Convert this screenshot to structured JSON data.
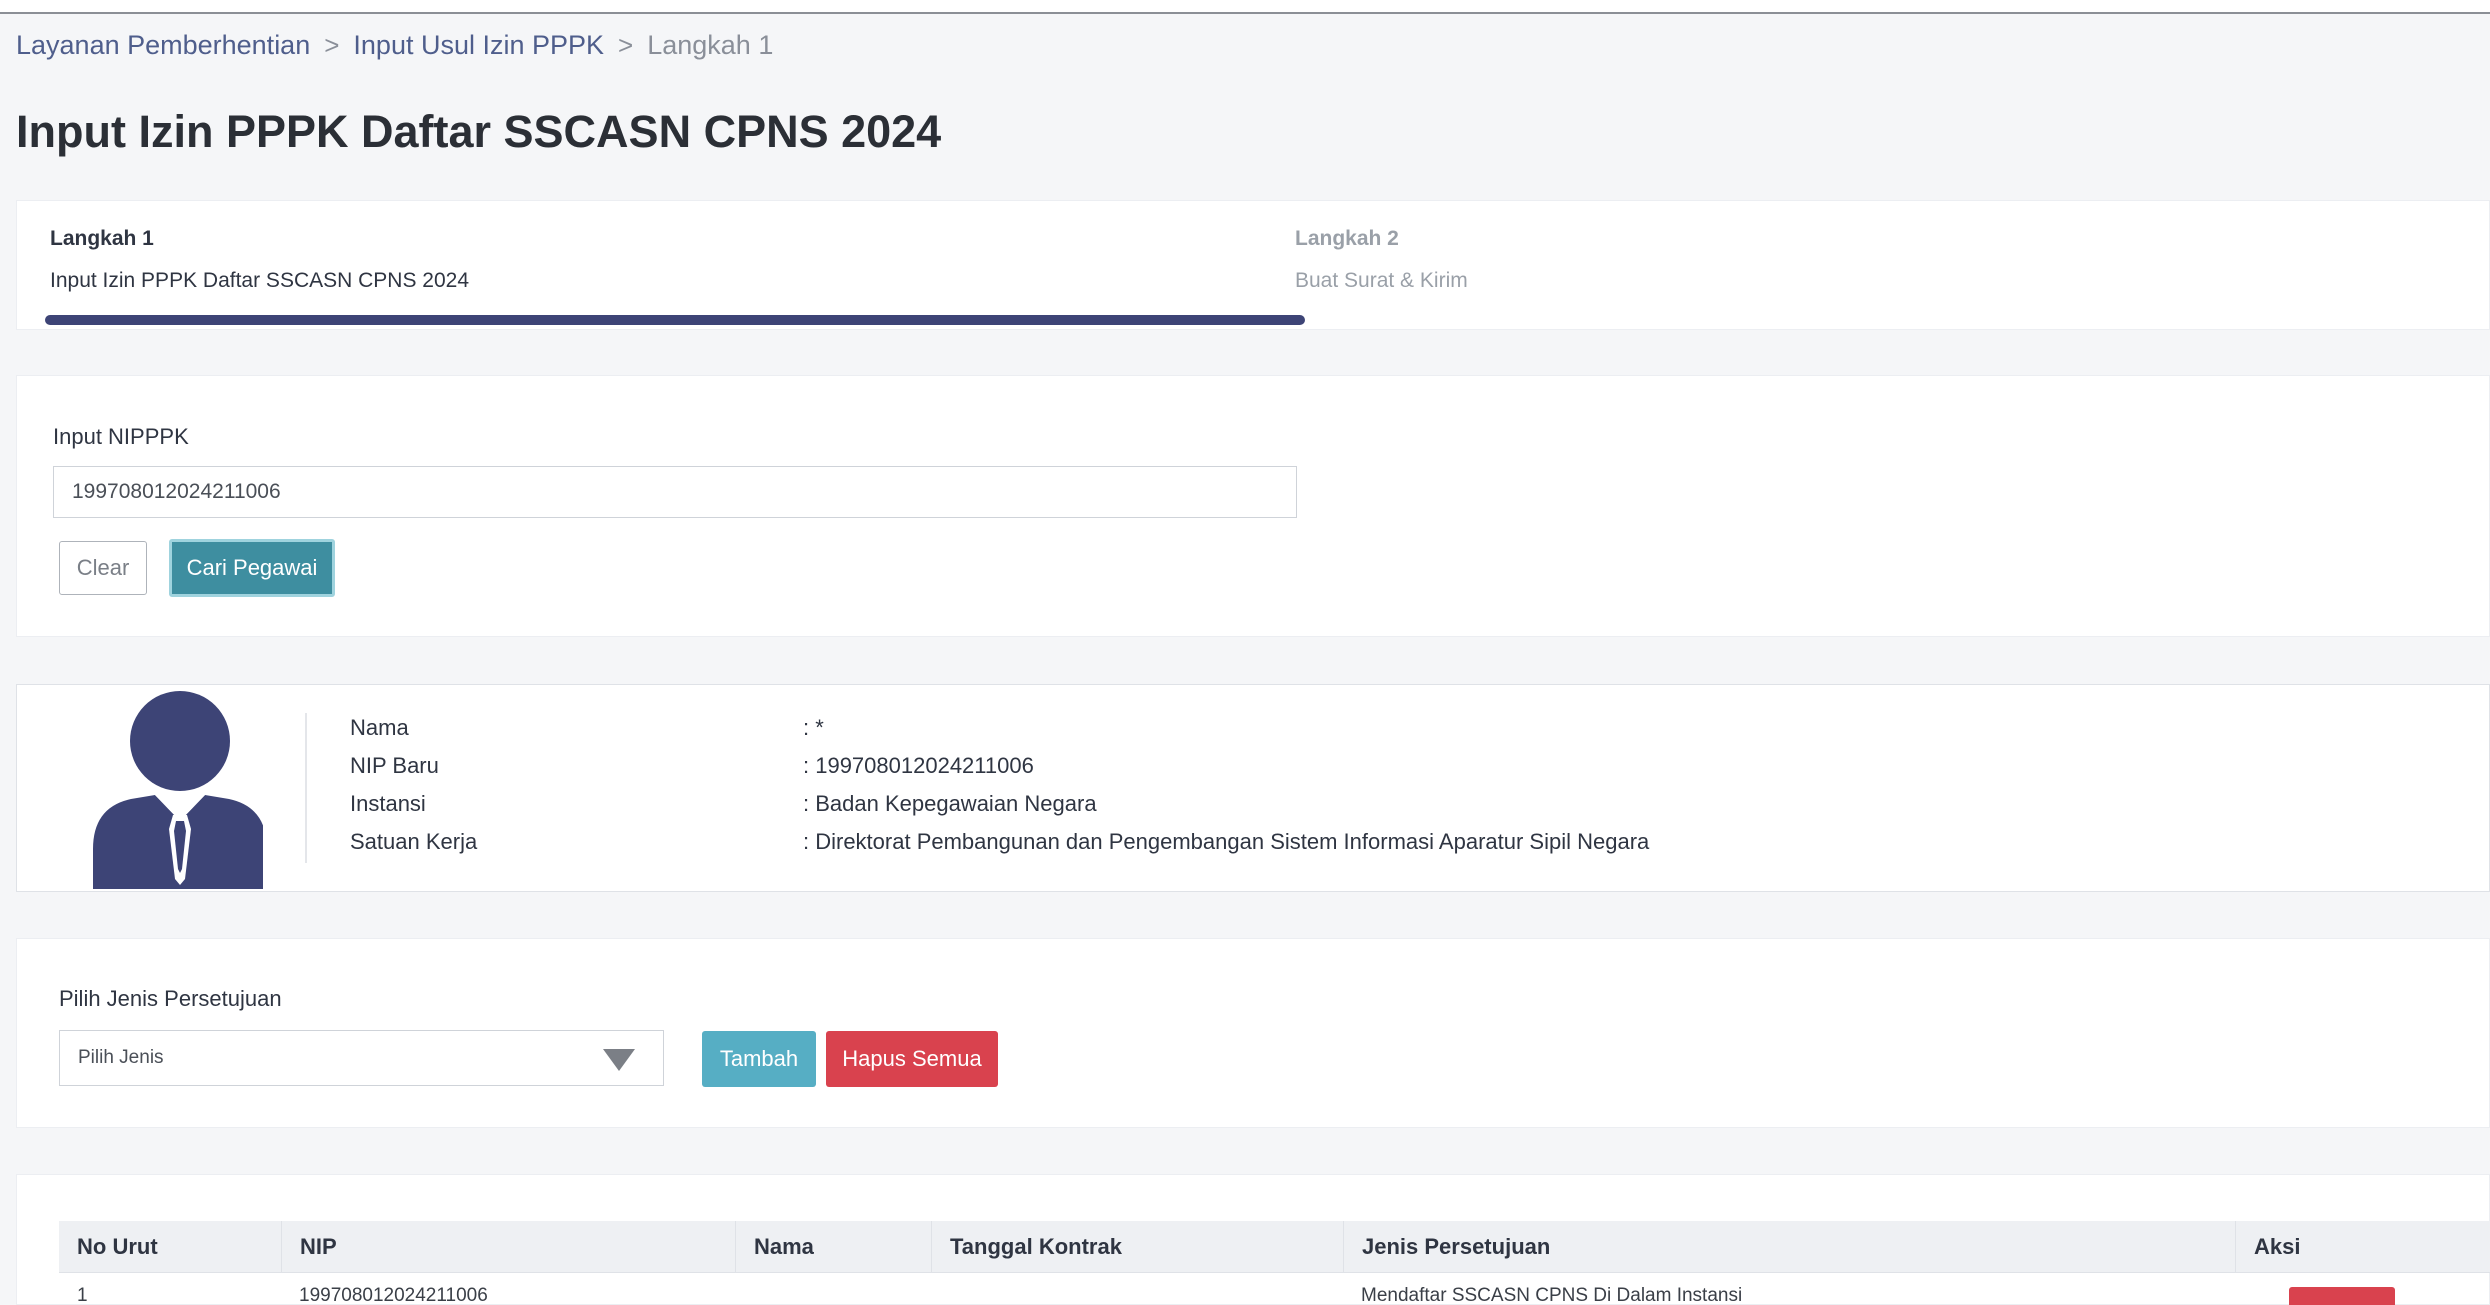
{
  "breadcrumb": {
    "items": [
      "Layanan Pemberhentian",
      "Input Usul Izin PPPK",
      "Langkah 1"
    ],
    "separator": ">"
  },
  "page": {
    "title": "Input Izin PPPK Daftar SSCASN CPNS 2024"
  },
  "stepper": {
    "steps": [
      {
        "title": "Langkah 1",
        "subtitle": "Input Izin PPPK Daftar SSCASN CPNS 2024",
        "active": true
      },
      {
        "title": "Langkah 2",
        "subtitle": "Buat Surat & Kirim",
        "active": false
      }
    ],
    "progress_fraction": 0.5,
    "progress_color": "#3d4476"
  },
  "search": {
    "label": "Input NIPPPK",
    "value": "199708012024211006",
    "clear_label": "Clear",
    "search_label": "Cari Pegawai"
  },
  "profile": {
    "avatar_icon": "user-avatar-icon",
    "avatar_color": "#3d4476",
    "fields": [
      {
        "key": "Nama",
        "value": ": *"
      },
      {
        "key": "NIP Baru",
        "value": ": 199708012024211006"
      },
      {
        "key": "Instansi",
        "value": ": Badan Kepegawaian Negara"
      },
      {
        "key": "Satuan Kerja",
        "value": ": Direktorat Pembangunan dan Pengembangan Sistem Informasi Aparatur Sipil Negara"
      }
    ]
  },
  "persetujuan": {
    "label": "Pilih Jenis Persetujuan",
    "select_value": "Pilih Jenis",
    "add_label": "Tambah",
    "delete_all_label": "Hapus Semua",
    "add_color": "#56aec4",
    "delete_color": "#d9424e"
  },
  "table": {
    "columns": [
      "No Urut",
      "NIP",
      "Nama",
      "Tanggal Kontrak",
      "Jenis Persetujuan",
      "Aksi"
    ],
    "rows": [
      {
        "no": "1",
        "nip": "199708012024211006",
        "nama": "",
        "tanggal": "",
        "jenis": "Mendaftar SSCASN CPNS Di Dalam Instansi",
        "aksi": ""
      }
    ]
  }
}
